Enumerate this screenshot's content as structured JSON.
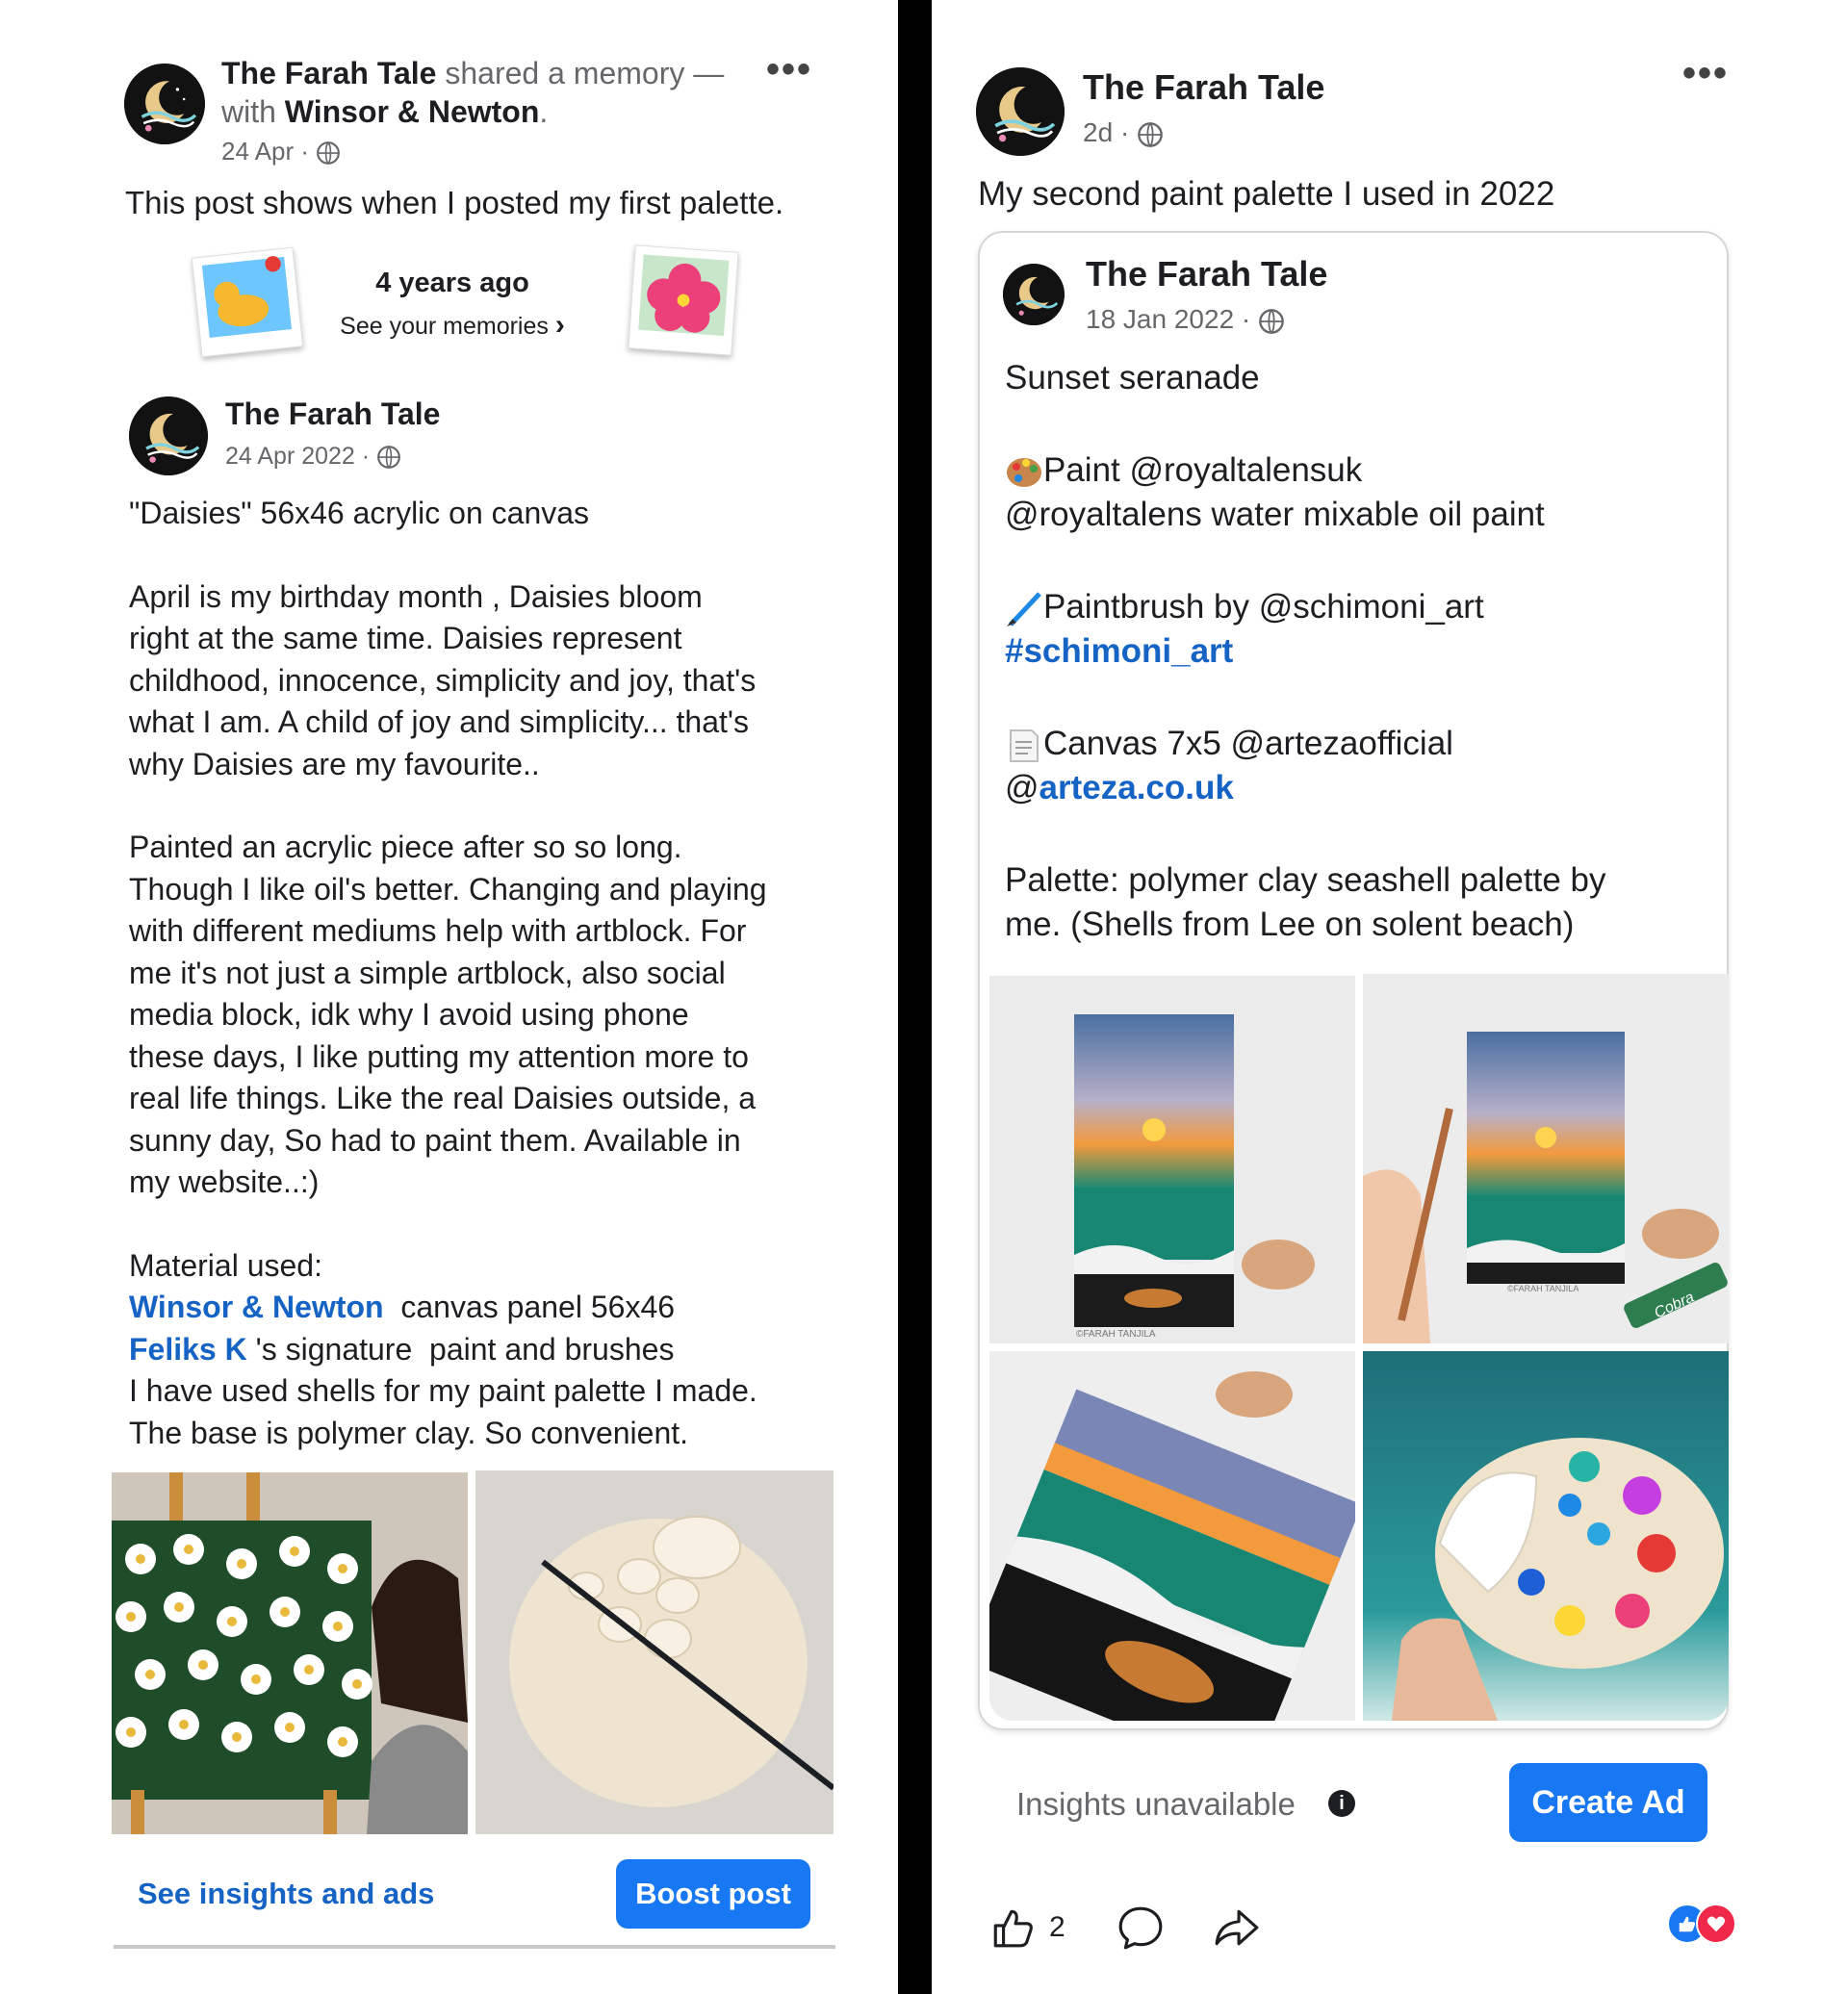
{
  "left": {
    "header": {
      "author": "The Farah Tale",
      "shared_text": "shared a memory —",
      "with_text": "with",
      "partner": "Winsor & Newton",
      "period": ".",
      "date": "24 Apr",
      "dot": "·"
    },
    "memory_caption": "This post shows when I posted my first palette.",
    "memories": {
      "years_ago": "4 years ago",
      "see_memories": "See your memories",
      "chevron": "›"
    },
    "post": {
      "author": "The Farah Tale",
      "date": "24 Apr 2022",
      "dot": "·",
      "title_line": "\"Daisies\" 56x46 acrylic  on canvas",
      "para1": "April is my birthday month , Daisies bloom\nright at the same time. Daisies represent\nchildhood, innocence,  simplicity  and joy, that's\nwhat I am. A child of joy and simplicity... that's\nwhy Daisies are my favourite..",
      "para2": "Painted an acrylic  piece after so so long.\nThough I like oil's better. Changing and playing\nwith different  mediums help with artblock. For\nme it's not just a simple artblock, also social\nmedia  block,  idk why I avoid using phone\nthese days, I like putting my attention more to\nreal life things. Like the real Daisies outside, a\nsunny day,  So had to paint them. Available  in\nmy website..:)",
      "material_heading": "Material used:",
      "material_1_link": "Winsor & Newton",
      "material_1_rest": "  canvas panel 56x46",
      "material_2_link": "Feliks K",
      "material_2_rest": " 's signature  paint and brushes",
      "material_3": "I have used shells for my paint palette I made.",
      "material_4": "The base is polymer clay. So convenient."
    },
    "footer": {
      "insights_link": "See insights and ads",
      "boost_button": "Boost post"
    }
  },
  "right": {
    "header": {
      "author": "The Farah Tale",
      "date": "2d",
      "dot": "·"
    },
    "caption": "My second paint palette I used in 2022",
    "shared": {
      "author": "The Farah Tale",
      "date": "18 Jan 2022",
      "dot": "·",
      "title": "Sunset seranade",
      "paint_line1": "Paint @royaltalensuk",
      "paint_line2": "@royaltalens water mixable oil paint",
      "brush_line": "Paintbrush by @schimoni_art",
      "brush_tag": "#schimoni_art",
      "canvas_line": "Canvas 7x5 @artezaofficial",
      "canvas_at": "@",
      "canvas_link": "arteza.co.uk",
      "palette_line1": "Palette: polymer clay seashell palette by",
      "palette_line2": "me. (Shells from Lee on solent beach)",
      "watermark1": "©FARAH TANJILA",
      "watermark2": "©FARAH TANJILA",
      "tube_label": "Cobra"
    },
    "insights": {
      "text": "Insights unavailable",
      "info_icon": "i",
      "create_ad_button": "Create Ad"
    },
    "actions": {
      "like_count": "2"
    }
  },
  "colors": {
    "link": "#1563c4",
    "button": "#1877f2",
    "meta": "#65676b",
    "divider": "#000000"
  },
  "icons": [
    "more-options-icon",
    "globe-icon",
    "chevron-right-icon",
    "palette-emoji-icon",
    "paintbrush-emoji-icon",
    "page-emoji-icon",
    "info-icon",
    "like-icon",
    "comment-icon",
    "share-icon",
    "like-reaction-icon",
    "love-reaction-icon"
  ]
}
